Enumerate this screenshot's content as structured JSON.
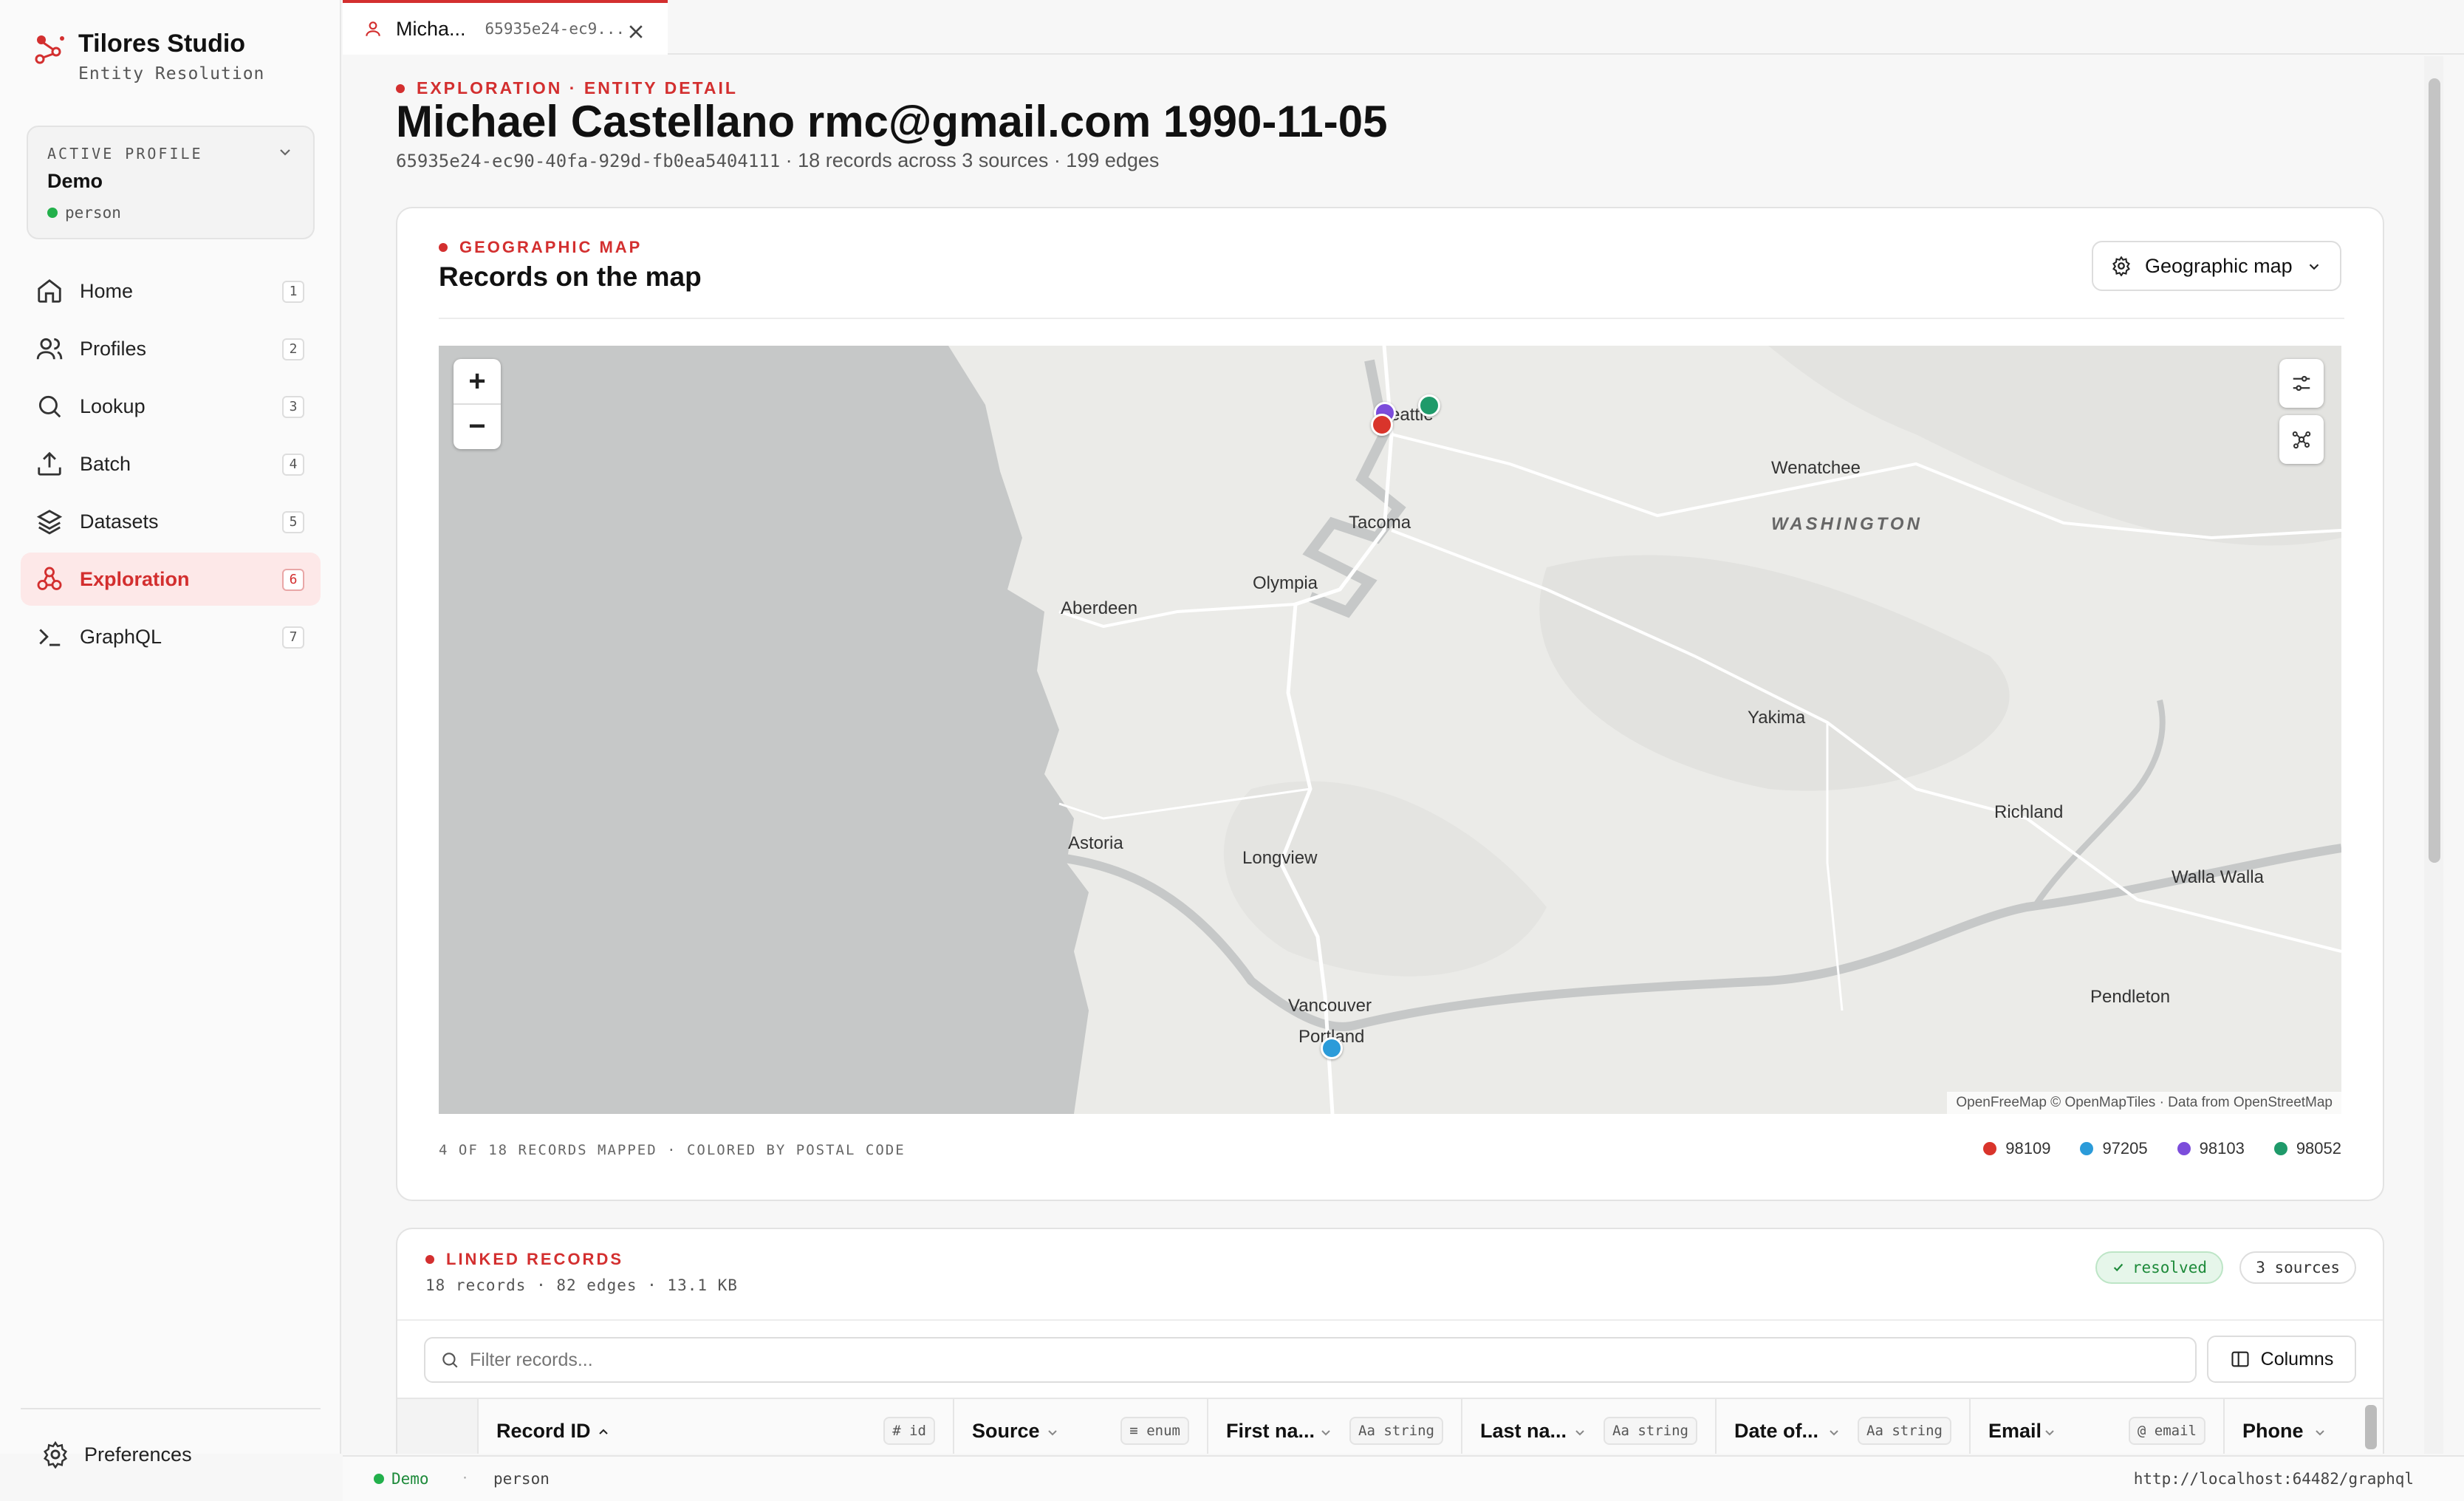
{
  "brand": {
    "title": "Tilores Studio",
    "subtitle": "Entity Resolution"
  },
  "profile_card": {
    "label": "ACTIVE PROFILE",
    "name": "Demo",
    "type": "person"
  },
  "nav": [
    {
      "label": "Home",
      "key": "1",
      "icon": "home-icon"
    },
    {
      "label": "Profiles",
      "key": "2",
      "icon": "users-icon"
    },
    {
      "label": "Lookup",
      "key": "3",
      "icon": "search-icon"
    },
    {
      "label": "Batch",
      "key": "4",
      "icon": "upload-icon"
    },
    {
      "label": "Datasets",
      "key": "5",
      "icon": "layers-icon"
    },
    {
      "label": "Exploration",
      "key": "6",
      "icon": "graph-icon",
      "active": true
    },
    {
      "label": "GraphQL",
      "key": "7",
      "icon": "terminal-icon"
    }
  ],
  "preferences_label": "Preferences",
  "tab": {
    "title": "Micha...",
    "id": "65935e24-ec9..."
  },
  "entity": {
    "breadcrumb": "EXPLORATION · ENTITY DETAIL",
    "title": "Michael Castellano rmc@gmail.com 1990-11-05",
    "id": "65935e24-ec90-40fa-929d-fb0ea5404111",
    "summary": " · 18 records across 3 sources · 199 edges"
  },
  "map_card": {
    "eyebrow": "GEOGRAPHIC MAP",
    "title": "Records on the map",
    "view_button": "Geographic map",
    "zoom_in": "+",
    "zoom_out": "−",
    "attribution": "OpenFreeMap © OpenMapTiles · Data from OpenStreetMap",
    "footer": "4 OF 18 RECORDS MAPPED · COLORED BY POSTAL CODE",
    "cities": [
      "Seattle",
      "Wenatchee",
      "WASHINGTON",
      "Tacoma",
      "Olympia",
      "Aberdeen",
      "Yakima",
      "Richland",
      "Astoria",
      "Longview",
      "Walla Walla",
      "Pendleton",
      "Vancouver",
      "Portland"
    ],
    "legend": [
      {
        "label": "98109",
        "color": "#d9342b"
      },
      {
        "label": "97205",
        "color": "#2b9bd9"
      },
      {
        "label": "98103",
        "color": "#7c4ddb"
      },
      {
        "label": "98052",
        "color": "#1f9a6a"
      }
    ]
  },
  "linked": {
    "eyebrow": "LINKED RECORDS",
    "stats": "18 records · 82 edges · 13.1 KB",
    "status": "resolved",
    "sources": "3 sources",
    "filter_placeholder": "Filter records...",
    "columns_button": "Columns",
    "columns": [
      {
        "label": "Record ID",
        "type": "# id"
      },
      {
        "label": "Source",
        "type": "≡ enum"
      },
      {
        "label": "First na...",
        "type": "Aa string"
      },
      {
        "label": "Last na...",
        "type": "Aa string"
      },
      {
        "label": "Date of...",
        "type": "Aa string"
      },
      {
        "label": "Email",
        "type": "@ email"
      },
      {
        "label": "Phone",
        "type": ""
      }
    ]
  },
  "statusbar": {
    "profile": "Demo",
    "sep": "·",
    "type": "person",
    "url": "http://localhost:64482/graphql"
  }
}
